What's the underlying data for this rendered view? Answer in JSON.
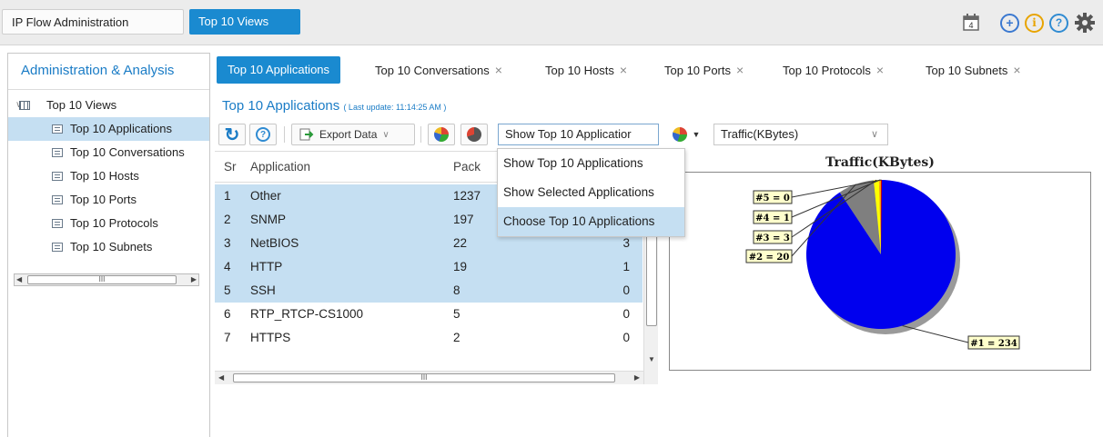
{
  "topbar": {
    "tabs": [
      "IP Flow Administration",
      "Top 10 Views"
    ],
    "calendar_badge": "4"
  },
  "sidebar": {
    "title": "Administration & Analysis",
    "root": "Top 10 Views",
    "items": [
      {
        "label": "Top 10 Applications",
        "selected": true
      },
      {
        "label": "Top 10 Conversations",
        "selected": false
      },
      {
        "label": "Top 10 Hosts",
        "selected": false
      },
      {
        "label": "Top 10 Ports",
        "selected": false
      },
      {
        "label": "Top 10 Protocols",
        "selected": false
      },
      {
        "label": "Top 10 Subnets",
        "selected": false
      }
    ],
    "scroll_grip": "III"
  },
  "main_tabs": [
    {
      "label": "Top 10 Applications",
      "active": true
    },
    {
      "label": "Top 10 Conversations",
      "close": "×"
    },
    {
      "label": "Top 10 Hosts",
      "close": "×"
    },
    {
      "label": "Top 10 Ports",
      "close": "×"
    },
    {
      "label": "Top 10 Protocols",
      "close": "×"
    },
    {
      "label": "Top 10 Subnets",
      "close": "×"
    }
  ],
  "section": {
    "title": "Top 10 Applications",
    "last_update": "( Last update: 11:14:25 AM )"
  },
  "toolbar": {
    "export_label": "Export Data",
    "view_select_value": "Show Top 10 Applicatior",
    "metric_select_value": "Traffic(KBytes)"
  },
  "dropdown": {
    "options": [
      "Show Top 10 Applications",
      "Show Selected Applications",
      "Choose Top 10 Applications"
    ],
    "highlighted_index": 2
  },
  "table": {
    "columns": [
      "Sr",
      "Application",
      "Pack"
    ],
    "rows": [
      {
        "sn": "1",
        "app": "Other",
        "packets": "1237",
        "pct": "",
        "selected": true
      },
      {
        "sn": "2",
        "app": "SNMP",
        "packets": "197",
        "pct": "",
        "selected": true
      },
      {
        "sn": "3",
        "app": "NetBIOS",
        "packets": "22",
        "pct": "3",
        "selected": true
      },
      {
        "sn": "4",
        "app": "HTTP",
        "packets": "19",
        "pct": "1",
        "selected": true
      },
      {
        "sn": "5",
        "app": "SSH",
        "packets": "8",
        "pct": "0",
        "selected": true
      },
      {
        "sn": "6",
        "app": "RTP_RTCP-CS1000",
        "packets": "5",
        "pct": "0",
        "selected": false
      },
      {
        "sn": "7",
        "app": "HTTPS",
        "packets": "2",
        "pct": "0",
        "selected": false
      }
    ],
    "scroll_grip": "III"
  },
  "chart_data": {
    "type": "pie",
    "title": "Traffic(KBytes)",
    "labels": [
      "#1 = 234",
      "#2 = 20",
      "#3 = 3",
      "#4 = 1",
      "#5 = 0"
    ],
    "values": [
      234,
      20,
      3,
      1,
      0
    ],
    "colors": [
      "#0000ee",
      "#7f7f7f",
      "#ffff00",
      "#ff9900",
      "#cc0000"
    ]
  }
}
